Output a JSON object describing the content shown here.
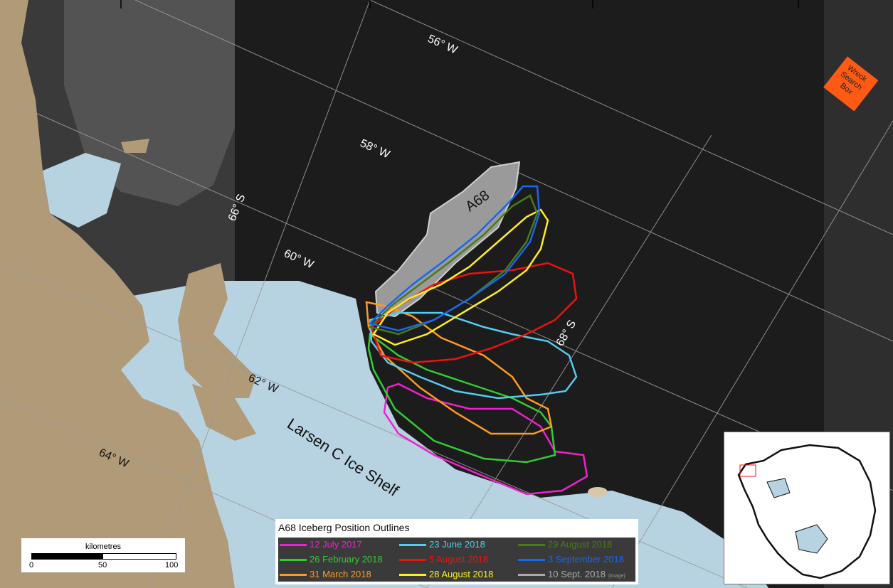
{
  "map": {
    "longitude_labels": [
      "56° W",
      "58° W",
      "60° W",
      "62° W",
      "64° W"
    ],
    "latitude_labels": [
      "66° S",
      "68° S"
    ],
    "iceberg_label": "A68",
    "ice_shelf_label": "Larsen C Ice Shelf",
    "search_box_label": "Wreck Search Box",
    "colors": {
      "ocean": "#1c1c1c",
      "ice_shelf": "#b7d3e2",
      "land": "#b09a78",
      "search_box": "#ff5a14",
      "iceberg_fill": "#9a9a9a"
    }
  },
  "legend": {
    "title": "A68 Iceberg Position Outlines",
    "items": [
      {
        "label": "12 July 2017",
        "color": "#ee22cc"
      },
      {
        "label": "26 February 2018",
        "color": "#33cc33"
      },
      {
        "label": "31 March 2018",
        "color": "#ff9922"
      },
      {
        "label": "23 June 2018",
        "color": "#55ccee"
      },
      {
        "label": "5 August 2018",
        "color": "#ee1111"
      },
      {
        "label": "28 August 2018",
        "color": "#ffee22"
      },
      {
        "label": "29 August 2018",
        "color": "#4a7a1a"
      },
      {
        "label": "3 September 2018",
        "color": "#1a66ee"
      },
      {
        "label": "10 Sept. 2018",
        "color": "#aaaaaa",
        "note": "(image)"
      }
    ]
  },
  "scalebar": {
    "title": "kilometres",
    "ticks": [
      "0",
      "50",
      "100"
    ]
  }
}
